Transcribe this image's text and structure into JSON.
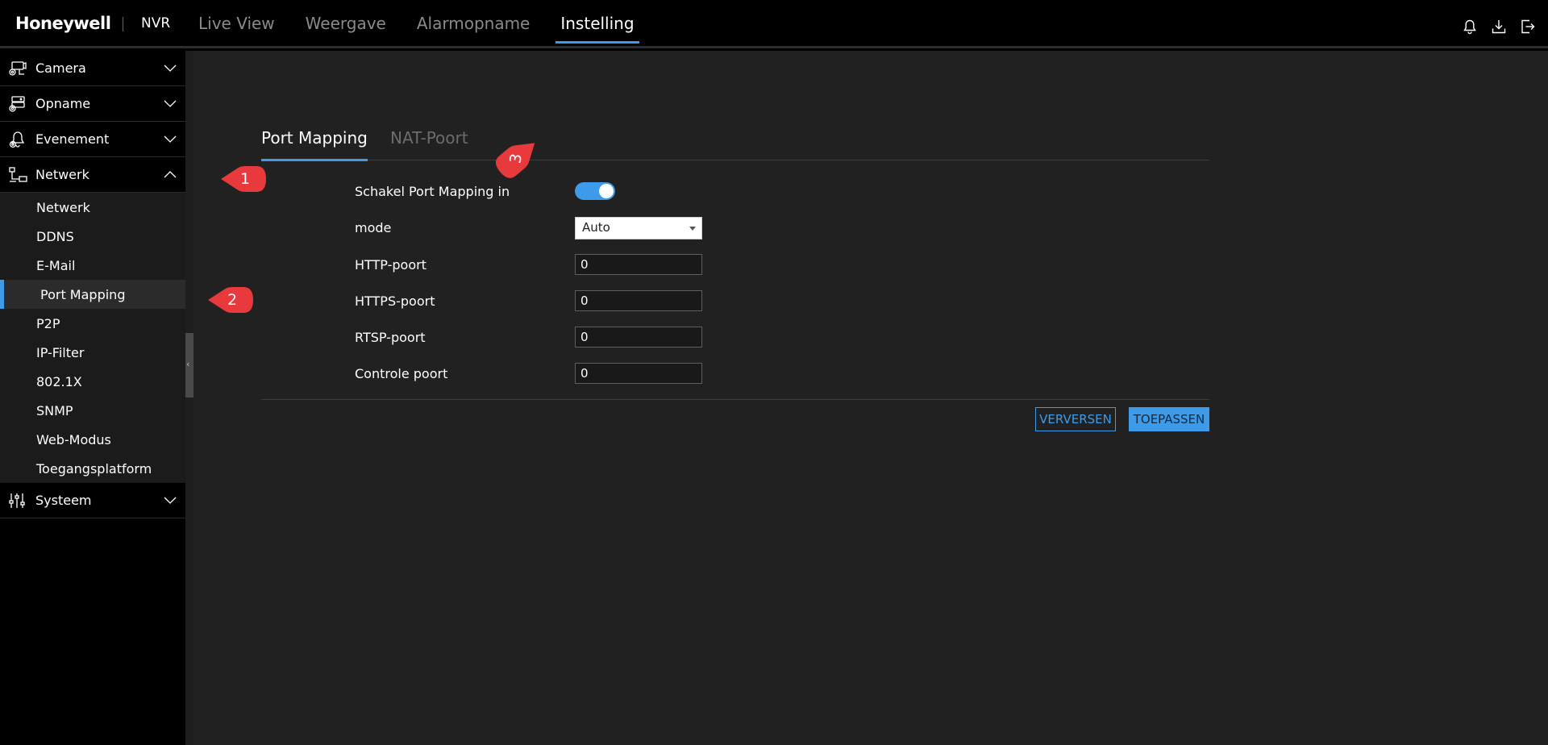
{
  "header": {
    "brand": "Honeywell",
    "product": "NVR",
    "nav": [
      {
        "label": "Live View",
        "active": false
      },
      {
        "label": "Weergave",
        "active": false
      },
      {
        "label": "Alarmopname",
        "active": false
      },
      {
        "label": "Instelling",
        "active": true
      }
    ],
    "icons": [
      "bell-icon",
      "download-icon",
      "logout-icon"
    ]
  },
  "sidebar": {
    "groups": [
      {
        "label": "Camera",
        "icon": "camera-icon",
        "expanded": false
      },
      {
        "label": "Opname",
        "icon": "recording-icon",
        "expanded": false
      },
      {
        "label": "Evenement",
        "icon": "event-icon",
        "expanded": false
      },
      {
        "label": "Netwerk",
        "icon": "network-icon",
        "expanded": true
      },
      {
        "label": "Systeem",
        "icon": "system-icon",
        "expanded": false
      }
    ],
    "network_items": [
      {
        "label": "Netwerk"
      },
      {
        "label": "DDNS"
      },
      {
        "label": "E-Mail"
      },
      {
        "label": "Port Mapping",
        "active": true
      },
      {
        "label": "P2P"
      },
      {
        "label": "IP-Filter"
      },
      {
        "label": "802.1X"
      },
      {
        "label": "SNMP"
      },
      {
        "label": "Web-Modus"
      },
      {
        "label": "Toegangsplatform"
      }
    ]
  },
  "main": {
    "tabs": [
      {
        "label": "Port Mapping",
        "active": true
      },
      {
        "label": "NAT-Poort",
        "active": false
      }
    ],
    "form": {
      "enable_label": "Schakel Port Mapping in",
      "enable_value": true,
      "mode_label": "mode",
      "mode_value": "Auto",
      "http_label": "HTTP-poort",
      "http_value": "0",
      "https_label": "HTTPS-poort",
      "https_value": "0",
      "rtsp_label": "RTSP-poort",
      "rtsp_value": "0",
      "control_label": "Controle poort",
      "control_value": "0"
    },
    "buttons": {
      "refresh": "VERVERSEN",
      "apply": "TOEPASSEN"
    }
  },
  "callouts": [
    "1",
    "2",
    "3"
  ],
  "colors": {
    "accent": "#3d9be9",
    "callout": "#e8393d",
    "background": "#212121"
  }
}
